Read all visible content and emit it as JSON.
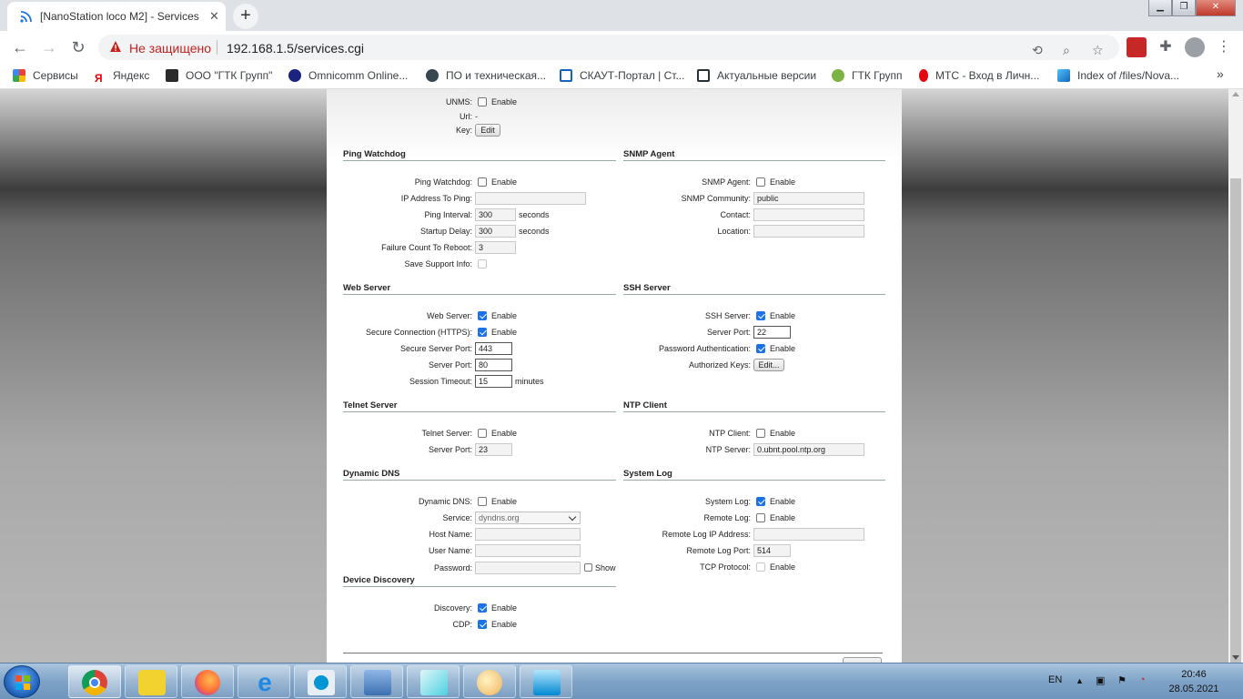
{
  "browser": {
    "tab_title": "[NanoStation loco M2] - Services",
    "tab_close": "✕",
    "new_tab": "+",
    "insecure_label": "Не защищено",
    "url": "192.168.1.5/services.cgi",
    "bookmarks": [
      "Сервисы",
      "Яндекс",
      "ООО \"ГТК Групп\"",
      "Omnicomm Online...",
      "ПО и техническая...",
      "СКАУТ-Портал | Ст...",
      "Актуальные версии",
      "ГТК Групп",
      "МТС - Вход в Личн...",
      "Index of /files/Nova..."
    ],
    "bookmarks_more": "»"
  },
  "unms": {
    "label": "UNMS:",
    "enable": "Enable",
    "url_label": "Url:",
    "url_value": "-",
    "key_label": "Key:",
    "edit_button": "Edit"
  },
  "ping_watchdog": {
    "title": "Ping Watchdog",
    "watchdog_label": "Ping Watchdog:",
    "enable": "Enable",
    "ip_label": "IP Address To Ping:",
    "ip_value": "",
    "interval_label": "Ping Interval:",
    "interval_value": "300",
    "interval_unit": "seconds",
    "startup_label": "Startup Delay:",
    "startup_value": "300",
    "startup_unit": "seconds",
    "failure_label": "Failure Count To Reboot:",
    "failure_value": "3",
    "support_label": "Save Support Info:"
  },
  "snmp": {
    "title": "SNMP Agent",
    "agent_label": "SNMP Agent:",
    "enable": "Enable",
    "community_label": "SNMP Community:",
    "community_value": "public",
    "contact_label": "Contact:",
    "contact_value": "",
    "location_label": "Location:",
    "location_value": ""
  },
  "web_server": {
    "title": "Web Server",
    "server_label": "Web Server:",
    "enable": "Enable",
    "https_label": "Secure Connection (HTTPS):",
    "https_enable": "Enable",
    "secure_port_label": "Secure Server Port:",
    "secure_port_value": "443",
    "port_label": "Server Port:",
    "port_value": "80",
    "timeout_label": "Session Timeout:",
    "timeout_value": "15",
    "timeout_unit": "minutes"
  },
  "ssh_server": {
    "title": "SSH Server",
    "server_label": "SSH Server:",
    "enable": "Enable",
    "port_label": "Server Port:",
    "port_value": "22",
    "auth_label": "Password Authentication:",
    "auth_enable": "Enable",
    "keys_label": "Authorized Keys:",
    "keys_button": "Edit..."
  },
  "telnet": {
    "title": "Telnet Server",
    "server_label": "Telnet Server:",
    "enable": "Enable",
    "port_label": "Server Port:",
    "port_value": "23"
  },
  "ntp": {
    "title": "NTP Client",
    "client_label": "NTP Client:",
    "enable": "Enable",
    "server_label": "NTP Server:",
    "server_value": "0.ubnt.pool.ntp.org"
  },
  "ddns": {
    "title": "Dynamic DNS",
    "ddns_label": "Dynamic DNS:",
    "enable": "Enable",
    "service_label": "Service:",
    "service_value": "dyndns.org",
    "host_label": "Host Name:",
    "host_value": "",
    "user_label": "User Name:",
    "user_value": "",
    "password_label": "Password:",
    "password_value": "",
    "show_label": "Show"
  },
  "syslog": {
    "title": "System Log",
    "log_label": "System Log:",
    "enable": "Enable",
    "remote_label": "Remote Log:",
    "remote_enable": "Enable",
    "remote_ip_label": "Remote Log IP Address:",
    "remote_ip_value": "",
    "remote_port_label": "Remote Log Port:",
    "remote_port_value": "514",
    "tcp_label": "TCP Protocol:",
    "tcp_enable": "Enable"
  },
  "discovery": {
    "title": "Device Discovery",
    "discovery_label": "Discovery:",
    "enable": "Enable",
    "cdp_label": "CDP:",
    "cdp_enable": "Enable"
  },
  "taskbar": {
    "lang": "EN",
    "time": "20:46",
    "date": "28.05.2021"
  }
}
